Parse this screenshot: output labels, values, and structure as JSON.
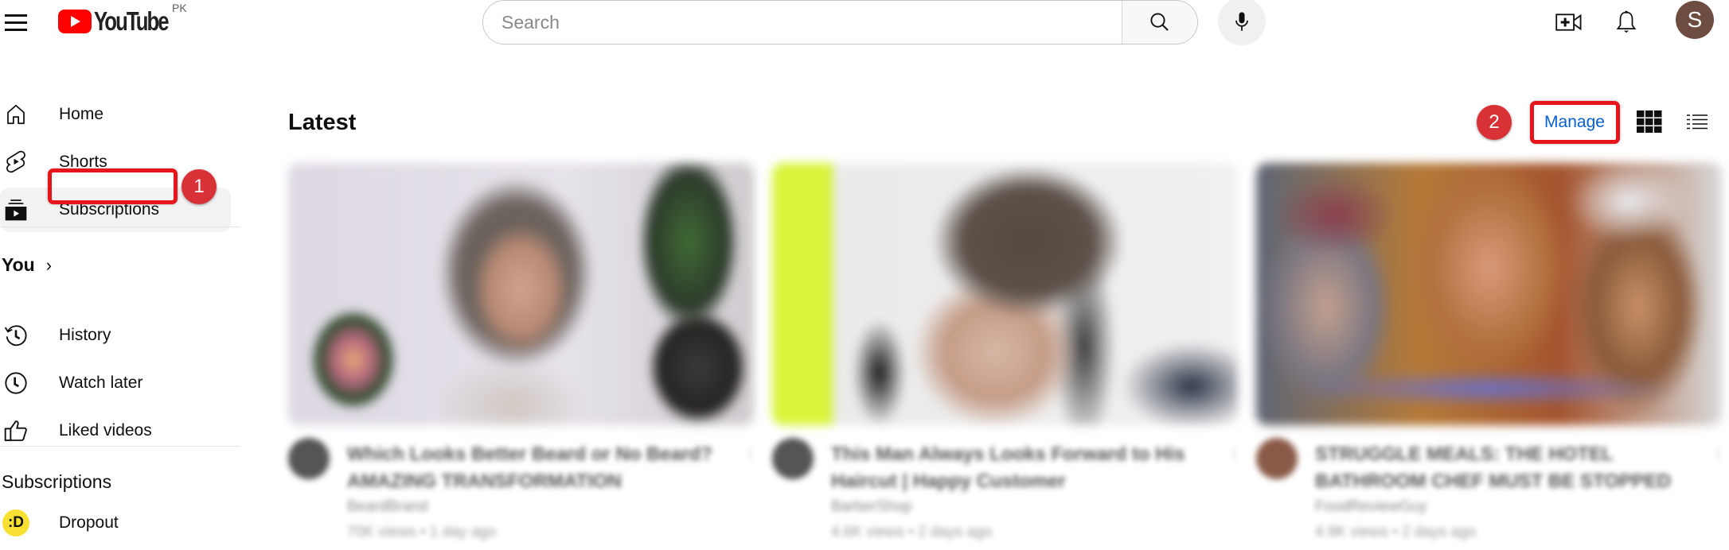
{
  "header": {
    "logo_text": "YouTube",
    "region": "PK",
    "search": {
      "placeholder": "Search",
      "value": ""
    },
    "icons": [
      "menu-icon",
      "search-icon",
      "mic-icon",
      "create-video-icon",
      "notifications-bell-icon"
    ],
    "avatar_letter": "S",
    "avatar_color": "#6d4c41"
  },
  "sidebar": {
    "main_items": [
      {
        "label": "Home",
        "icon": "home-icon"
      },
      {
        "label": "Shorts",
        "icon": "shorts-icon"
      },
      {
        "label": "Subscriptions",
        "icon": "subscriptions-icon",
        "active": true
      }
    ],
    "you_section": {
      "title": "You",
      "chevron": "›",
      "items": [
        {
          "label": "History",
          "icon": "history-icon"
        },
        {
          "label": "Watch later",
          "icon": "watch-later-icon"
        },
        {
          "label": "Liked videos",
          "icon": "liked-videos-icon"
        }
      ]
    },
    "subscriptions_section": {
      "title": "Subscriptions",
      "items": [
        {
          "label": "Dropout",
          "avatar_text": ":D",
          "avatar_color": "#f7e031"
        }
      ]
    }
  },
  "annotations": [
    {
      "step": "1",
      "target": "Subscriptions",
      "color": "#e8141c"
    },
    {
      "step": "2",
      "target": "Manage",
      "color": "#e8141c"
    }
  ],
  "main": {
    "heading": "Latest",
    "manage_label": "Manage",
    "view_options": [
      "grid-view-icon",
      "list-view-icon"
    ],
    "videos": [
      {
        "title": "Which Looks Better Beard or No Beard? AMAZING TRANSFORMATION",
        "channel": "BeardBrand",
        "meta": "70K views • 1 day ago",
        "blurred": true
      },
      {
        "title": "This Man Always Looks Forward to His Haircut | Happy Customer",
        "channel": "BarberShop",
        "meta": "4.6K views • 2 days ago",
        "blurred": true
      },
      {
        "title": "STRUGGLE MEALS: THE HOTEL BATHROOM CHEF MUST BE STOPPED",
        "channel": "FoodReviewGuy",
        "meta": "4.9K views • 2 days ago",
        "blurred": true
      }
    ]
  }
}
